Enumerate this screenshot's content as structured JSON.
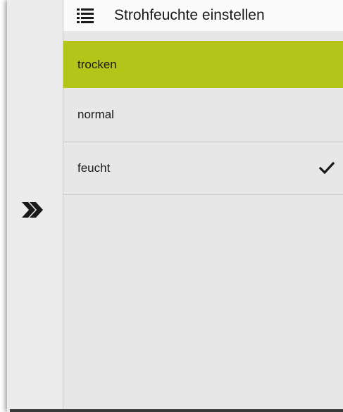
{
  "header": {
    "title": "Strohfeuchte einstellen",
    "icon": "list-icon"
  },
  "options": [
    {
      "label": "trocken",
      "selected": false,
      "highlighted": true
    },
    {
      "label": "normal",
      "selected": false,
      "highlighted": false
    },
    {
      "label": "feucht",
      "selected": true,
      "highlighted": false
    }
  ],
  "sidebar": {
    "expand_icon": "double-chevron-right-icon"
  },
  "colors": {
    "highlight": "#b5c418",
    "panel_bg": "#e7e7e7",
    "header_bg": "#fafafa"
  }
}
